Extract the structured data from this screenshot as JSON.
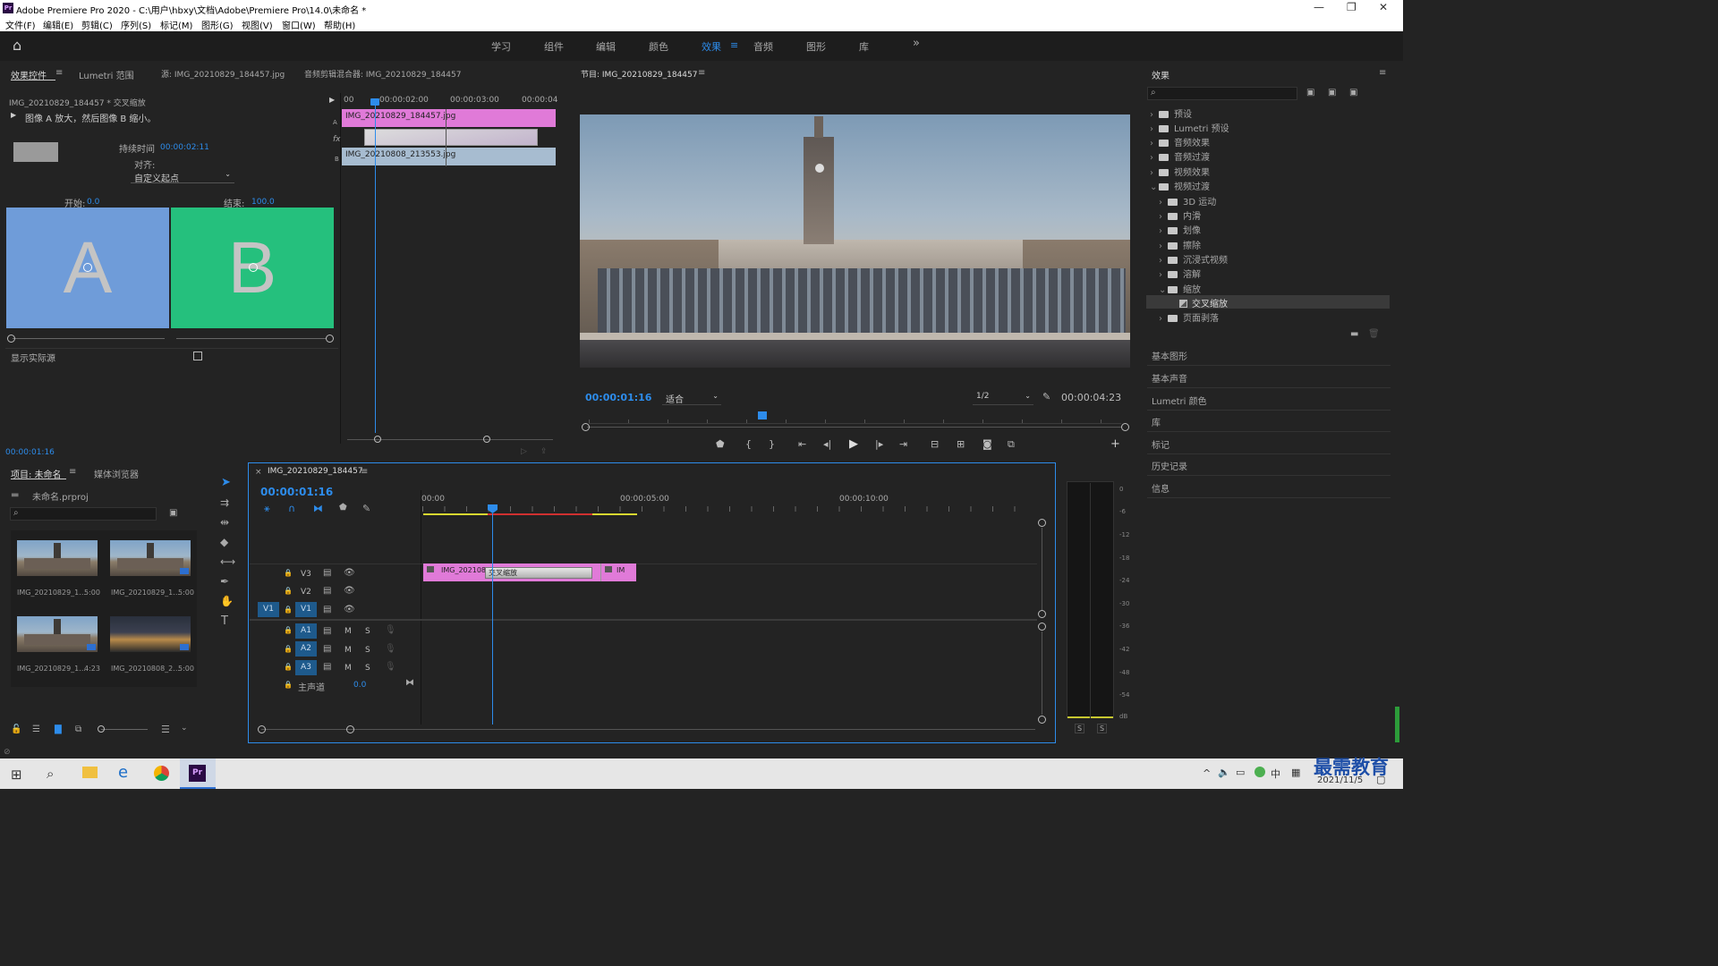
{
  "app": {
    "title": "Adobe Premiere Pro 2020 - C:\\用户\\hbxy\\文档\\Adobe\\Premiere Pro\\14.0\\未命名 *",
    "logo": "Pr"
  },
  "menu": [
    "文件(F)",
    "编辑(E)",
    "剪辑(C)",
    "序列(S)",
    "标记(M)",
    "图形(G)",
    "视图(V)",
    "窗口(W)",
    "帮助(H)"
  ],
  "workspaces": [
    "学习",
    "组件",
    "编辑",
    "颜色",
    "效果",
    "音频",
    "图形",
    "库"
  ],
  "workspace_more": "»",
  "source_panel": {
    "tabs": [
      "效果控件",
      "Lumetri 范围",
      "源: IMG_20210829_184457.jpg",
      "音频剪辑混合器: IMG_20210829_184457"
    ],
    "clip_path": "IMG_20210829_184457 * 交叉缩放",
    "description": "图像 A 放大，然后图像 B 缩小。",
    "duration_label": "持续时间",
    "duration_value": "00:00:02:11",
    "align_label": "对齐:",
    "align_value": "自定义起点",
    "start_label": "开始:",
    "start_value": "0.0",
    "end_label": "结束:",
    "end_value": "100.0",
    "letter_a": "A",
    "letter_b": "B",
    "show_source_label": "显示实际源",
    "timecode": "00:00:01:16",
    "mini_ruler": [
      "00",
      "00:00:02:00",
      "00:00:03:00",
      "00:00:04"
    ],
    "clip_a_label": "IMG_20210829_184457.jpg",
    "clip_b_label": "IMG_20210808_213553.jpg",
    "track_a": "A",
    "track_b": "B",
    "fx": "fx"
  },
  "program": {
    "title": "节目: IMG_20210829_184457",
    "timecode": "00:00:01:16",
    "fit": "适合",
    "resolution": "1/2",
    "duration": "00:00:04:23"
  },
  "effects": {
    "title": "效果",
    "tree": [
      {
        "label": "预设",
        "level": 0,
        "open": false
      },
      {
        "label": "Lumetri 预设",
        "level": 0,
        "open": false
      },
      {
        "label": "音频效果",
        "level": 0,
        "open": false
      },
      {
        "label": "音频过渡",
        "level": 0,
        "open": false
      },
      {
        "label": "视频效果",
        "level": 0,
        "open": false
      },
      {
        "label": "视频过渡",
        "level": 0,
        "open": true
      },
      {
        "label": "3D 运动",
        "level": 1,
        "open": false
      },
      {
        "label": "内滑",
        "level": 1,
        "open": false
      },
      {
        "label": "划像",
        "level": 1,
        "open": false
      },
      {
        "label": "擦除",
        "level": 1,
        "open": false
      },
      {
        "label": "沉浸式视频",
        "level": 1,
        "open": false
      },
      {
        "label": "溶解",
        "level": 1,
        "open": false
      },
      {
        "label": "缩放",
        "level": 1,
        "open": true
      },
      {
        "label": "交叉缩放",
        "level": 2,
        "open": false
      },
      {
        "label": "页面剥落",
        "level": 1,
        "open": false
      }
    ],
    "panels": [
      "基本图形",
      "基本声音",
      "Lumetri 颜色",
      "库",
      "标记",
      "历史记录",
      "信息"
    ]
  },
  "project": {
    "tabs": [
      "项目: 未命名",
      "媒体浏览器"
    ],
    "file": "未命名.prproj",
    "items": [
      {
        "name": "IMG_20210829_1...",
        "dur": "5:00"
      },
      {
        "name": "IMG_20210829_1...",
        "dur": "5:00"
      },
      {
        "name": "IMG_20210829_1...",
        "dur": "4:23"
      },
      {
        "name": "IMG_20210808_2...",
        "dur": "5:00"
      }
    ]
  },
  "timeline": {
    "tab": "IMG_20210829_184457",
    "timecode": "00:00:01:16",
    "ruler": [
      "00:00",
      "00:00:05:00",
      "00:00:10:00"
    ],
    "tracks_v": [
      "V3",
      "V2",
      "V1"
    ],
    "tracks_a": [
      "A1",
      "A2",
      "A3"
    ],
    "source_patch": "V1",
    "master_label": "主声道",
    "master_value": "0.0",
    "clip1": "IMG_202108",
    "transition": "交叉缩放",
    "clip2": "IM",
    "m": "M",
    "s": "S"
  },
  "meter": {
    "ticks": [
      "0",
      "-6",
      "-12",
      "-18",
      "-24",
      "-30",
      "-36",
      "-42",
      "-48",
      "-54",
      "dB"
    ],
    "solo": [
      "S",
      "S"
    ]
  },
  "taskbar": {
    "ime": "中",
    "time": "2021/11/5",
    "watermark": "最需教育"
  }
}
